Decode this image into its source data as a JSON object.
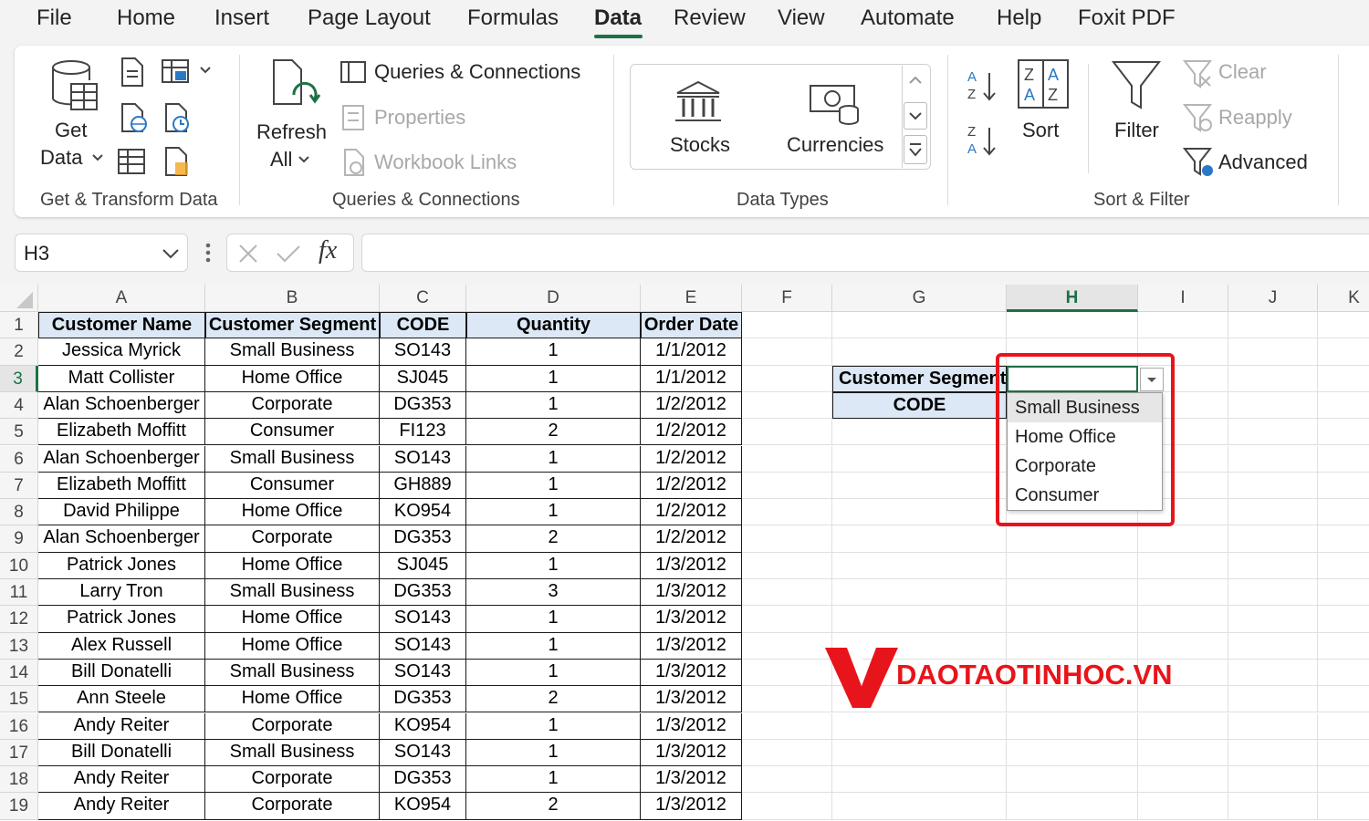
{
  "menu": {
    "tabs": [
      "File",
      "Home",
      "Insert",
      "Page Layout",
      "Formulas",
      "Data",
      "Review",
      "View",
      "Automate",
      "Help",
      "Foxit PDF"
    ],
    "active_tab": "Data"
  },
  "ribbon": {
    "get_transform": {
      "get_data_line1": "Get",
      "get_data_line2": "Data",
      "group_label": "Get & Transform Data"
    },
    "queries": {
      "refresh_line1": "Refresh",
      "refresh_line2": "All",
      "queries_connections": "Queries & Connections",
      "properties": "Properties",
      "workbook_links": "Workbook Links",
      "group_label": "Queries & Connections"
    },
    "data_types": {
      "stocks": "Stocks",
      "currencies": "Currencies",
      "group_label": "Data Types"
    },
    "sort_filter": {
      "sort": "Sort",
      "filter": "Filter",
      "clear": "Clear",
      "reapply": "Reapply",
      "advanced": "Advanced",
      "group_label": "Sort & Filter"
    }
  },
  "formula_bar": {
    "name_box": "H3",
    "fx": "fx",
    "formula": ""
  },
  "columns": [
    "A",
    "B",
    "C",
    "D",
    "E",
    "F",
    "G",
    "H",
    "I",
    "J",
    "K"
  ],
  "selected_column": "H",
  "selected_row": 3,
  "table": {
    "headers": [
      "Customer Name",
      "Customer Segment",
      "CODE",
      "Quantity",
      "Order Date"
    ],
    "rows": [
      [
        "Jessica Myrick",
        "Small Business",
        "SO143",
        "1",
        "1/1/2012"
      ],
      [
        "Matt Collister",
        "Home Office",
        "SJ045",
        "1",
        "1/1/2012"
      ],
      [
        "Alan Schoenberger",
        "Corporate",
        "DG353",
        "1",
        "1/2/2012"
      ],
      [
        "Elizabeth Moffitt",
        "Consumer",
        "FI123",
        "2",
        "1/2/2012"
      ],
      [
        "Alan Schoenberger",
        "Small Business",
        "SO143",
        "1",
        "1/2/2012"
      ],
      [
        "Elizabeth Moffitt",
        "Consumer",
        "GH889",
        "1",
        "1/2/2012"
      ],
      [
        "David Philippe",
        "Home Office",
        "KO954",
        "1",
        "1/2/2012"
      ],
      [
        "Alan Schoenberger",
        "Corporate",
        "DG353",
        "2",
        "1/2/2012"
      ],
      [
        "Patrick Jones",
        "Home Office",
        "SJ045",
        "1",
        "1/3/2012"
      ],
      [
        "Larry Tron",
        "Small Business",
        "DG353",
        "3",
        "1/3/2012"
      ],
      [
        "Patrick Jones",
        "Home Office",
        "SO143",
        "1",
        "1/3/2012"
      ],
      [
        "Alex Russell",
        "Home Office",
        "SO143",
        "1",
        "1/3/2012"
      ],
      [
        "Bill Donatelli",
        "Small Business",
        "SO143",
        "1",
        "1/3/2012"
      ],
      [
        "Ann Steele",
        "Home Office",
        "DG353",
        "2",
        "1/3/2012"
      ],
      [
        "Andy Reiter",
        "Corporate",
        "KO954",
        "1",
        "1/3/2012"
      ],
      [
        "Bill Donatelli",
        "Small Business",
        "SO143",
        "1",
        "1/3/2012"
      ],
      [
        "Andy Reiter",
        "Corporate",
        "DG353",
        "1",
        "1/3/2012"
      ],
      [
        "Andy Reiter",
        "Corporate",
        "KO954",
        "2",
        "1/3/2012"
      ]
    ]
  },
  "lookup": {
    "segment_label": "Customer Segment",
    "code_label": "CODE",
    "segment_value": ""
  },
  "dropdown": {
    "options": [
      "Small Business",
      "Home Office",
      "Corporate",
      "Consumer"
    ],
    "highlighted": 0
  },
  "watermark": {
    "text": "DAOTAOTINHOC.VN",
    "color": "#e8141b"
  },
  "colors": {
    "accent": "#1e7145",
    "header_fill": "#dce8f5",
    "highlight_box": "#e8141b"
  }
}
